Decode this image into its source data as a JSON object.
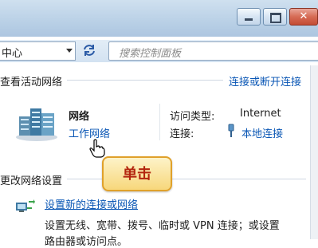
{
  "window": {
    "minimize_glyph": "",
    "maximize_glyph": "",
    "close_glyph": "✕"
  },
  "address_bar": {
    "path_text": "中心",
    "search_placeholder": "搜索控制面板"
  },
  "active_networks": {
    "title": "查看活动网络",
    "connect_link": "连接或断开连接",
    "network": {
      "name": "网络",
      "type_link": "工作网络"
    },
    "access_type_label": "访问类型:",
    "access_type_value": "Internet",
    "connections_label": "连接:",
    "connections_link": "本地连接"
  },
  "change_settings": {
    "title": "更改网络设置",
    "setup_link": "设置新的连接或网络",
    "setup_desc_line1": "设置无线、宽带、拨号、临时或 VPN 连接；或设置",
    "setup_desc_line2": "路由器或访问点。"
  },
  "tooltip": {
    "text": "单击"
  },
  "colors": {
    "link": "#0b57b5",
    "tooltip_border": "#e0a12b",
    "tooltip_text": "#b3260f"
  }
}
